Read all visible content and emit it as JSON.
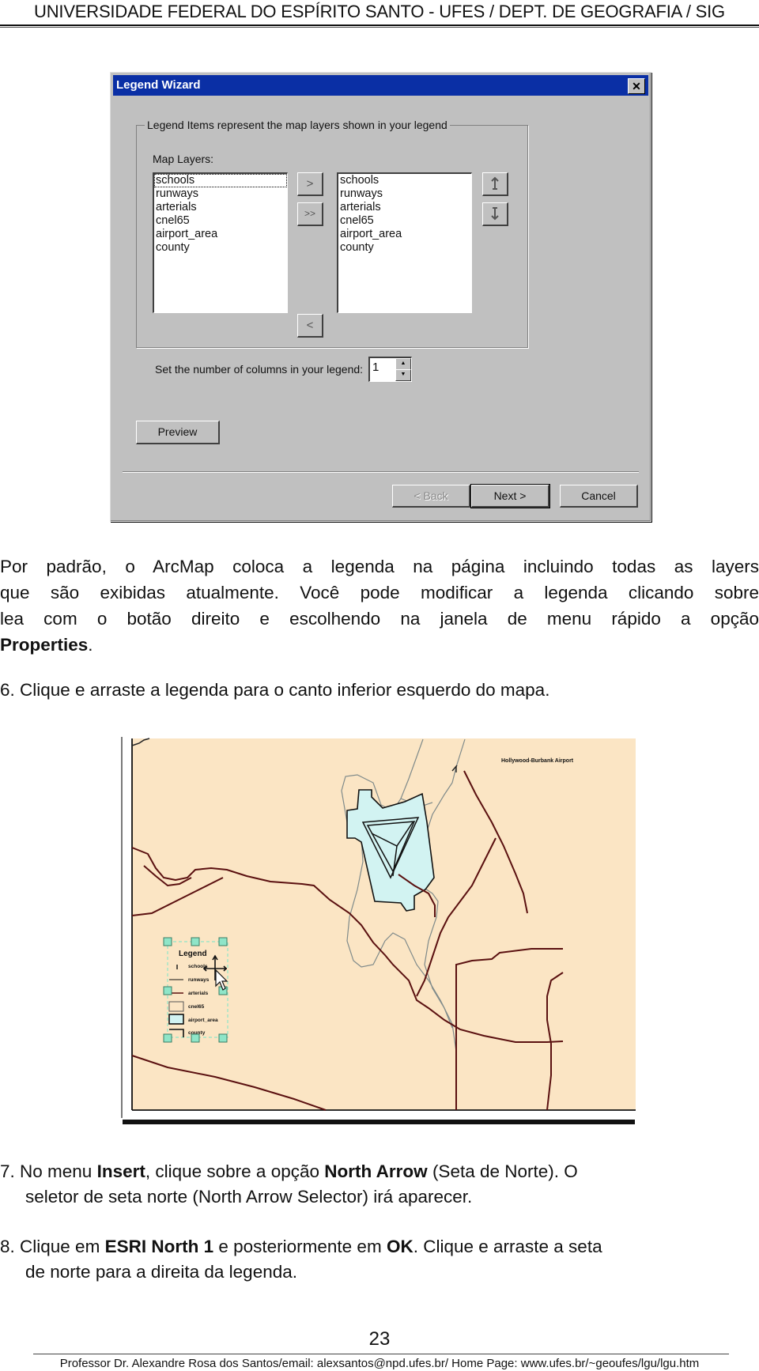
{
  "header": {
    "title": "UNIVERSIDADE FEDERAL DO ESPÍRITO SANTO - UFES / DEPT. DE GEOGRAFIA / SIG"
  },
  "dialog": {
    "title": "Legend Wizard",
    "close_icon": "close-icon",
    "group_label": "Legend Items represent the map layers shown in your legend",
    "map_layers_label": "Map Layers:",
    "map_layers": [
      "schools",
      "runways",
      "arterials",
      "cnel65",
      "airport_area",
      "county"
    ],
    "legend_items": [
      "schools",
      "runways",
      "arterials",
      "cnel65",
      "airport_area",
      "county"
    ],
    "add_button": ">",
    "add_all_button": ">>",
    "remove_button": "<",
    "move_up_icon": "arrow-up-icon",
    "move_down_icon": "arrow-down-icon",
    "columns_label": "Set the number of columns in your legend:",
    "columns_value": "1",
    "preview_button": "Preview",
    "back_button": "< Back",
    "next_button": "Next >",
    "cancel_button": "Cancel",
    "colors": {
      "titlebar": "#0a2fa5",
      "face": "#c0c0c0"
    }
  },
  "paragraph": {
    "lines": [
      "Por padrão, o ArcMap coloca a legenda na página incluindo todas as layers",
      "que são exibidas atualmente. Você pode modificar a legenda clicando sobre",
      "lea com o botão direito e escolhendo na janela de menu rápido a opção"
    ],
    "bold_end": "Properties",
    "end_punct": "."
  },
  "step6": "6. Clique e arraste a legenda para o canto inferior esquerdo do mapa.",
  "map": {
    "title_text": "Hollywood-Burbank Airport",
    "legend_title": "Legend",
    "legend_items": [
      "schools",
      "runways",
      "arterials",
      "cnel65",
      "airport_area",
      "county"
    ],
    "colors": {
      "background": "#fbe5c4",
      "airport": "#d2f3f2",
      "roads": "#5a1010",
      "boundary": "#7f8a8a",
      "handles": "#8fe5c8"
    }
  },
  "step7": {
    "p1": "7. No menu ",
    "b1": "Insert",
    "p2": ", clique sobre a opção ",
    "b2": "North Arrow",
    "p3": " (Seta de Norte). O",
    "line2": "seletor de seta norte (North Arrow Selector) irá aparecer."
  },
  "step8": {
    "p1": "8. Clique em ",
    "b1": "ESRI North 1",
    "p2": " e posteriormente em ",
    "b2": "OK",
    "p3": ". Clique e arraste a seta",
    "line2": "de norte para a direita da legenda."
  },
  "footer": {
    "page_number": "23",
    "text": "Professor Dr. Alexandre Rosa dos Santos/email: alexsantos@npd.ufes.br/ Home Page: www.ufes.br/~geoufes/lgu/lgu.htm"
  }
}
